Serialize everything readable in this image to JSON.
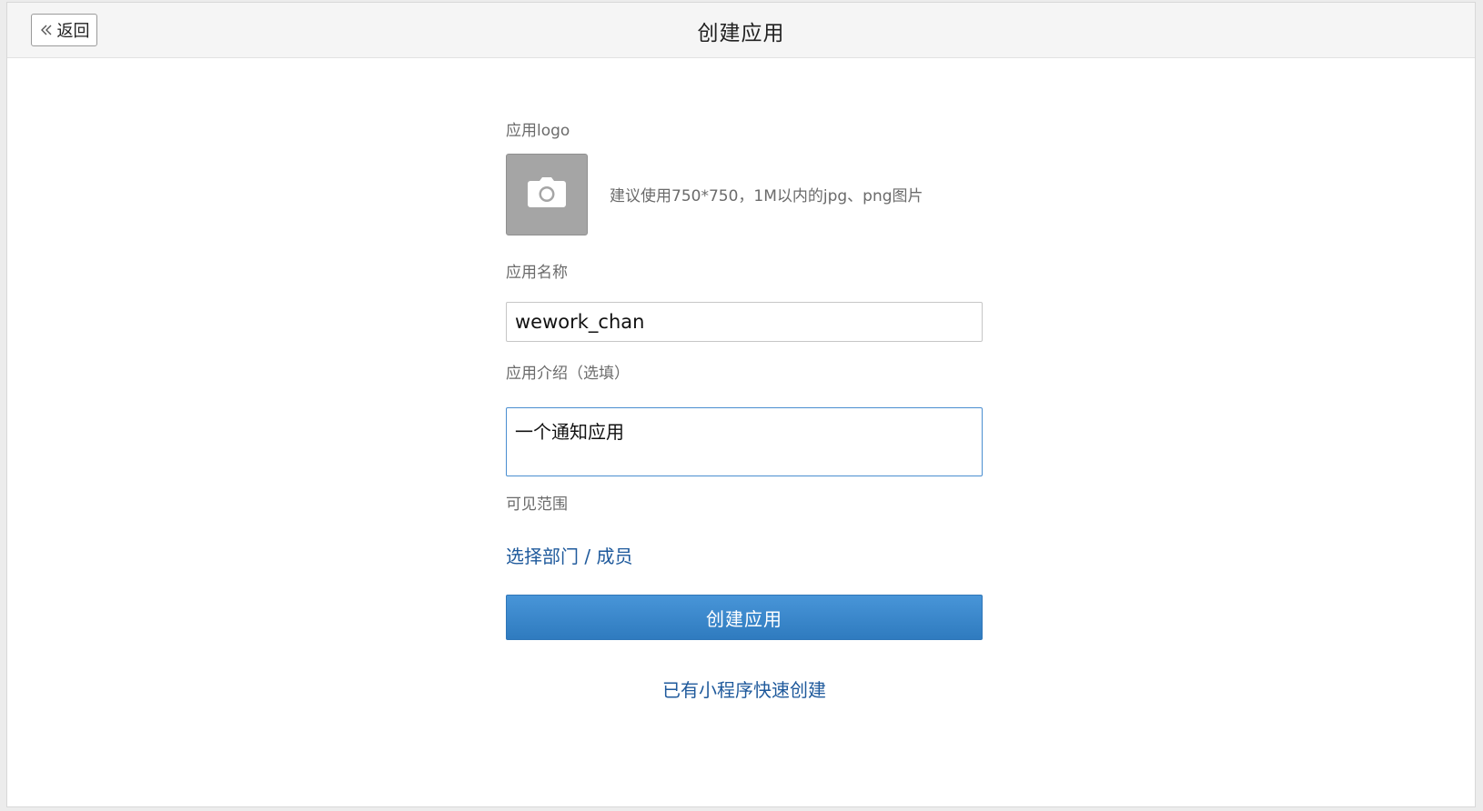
{
  "header": {
    "back_label": "返回",
    "back_icon": "double-chevron-left-icon",
    "title": "创建应用"
  },
  "form": {
    "logo": {
      "label": "应用logo",
      "icon": "camera-icon",
      "hint": "建议使用750*750，1M以内的jpg、png图片"
    },
    "name": {
      "label": "应用名称",
      "value": "wework_chan"
    },
    "description": {
      "label": "应用介绍（选填）",
      "value": "一个通知应用"
    },
    "scope": {
      "label": "可见范围",
      "link": "选择部门 / 成员"
    },
    "submit_label": "创建应用",
    "quick_create_link": "已有小程序快速创建"
  },
  "colors": {
    "primary_button": "#3a86c9",
    "link": "#1f5a9c",
    "focus_border": "#4a8ed0",
    "upload_tile": "#a5a5a5"
  }
}
